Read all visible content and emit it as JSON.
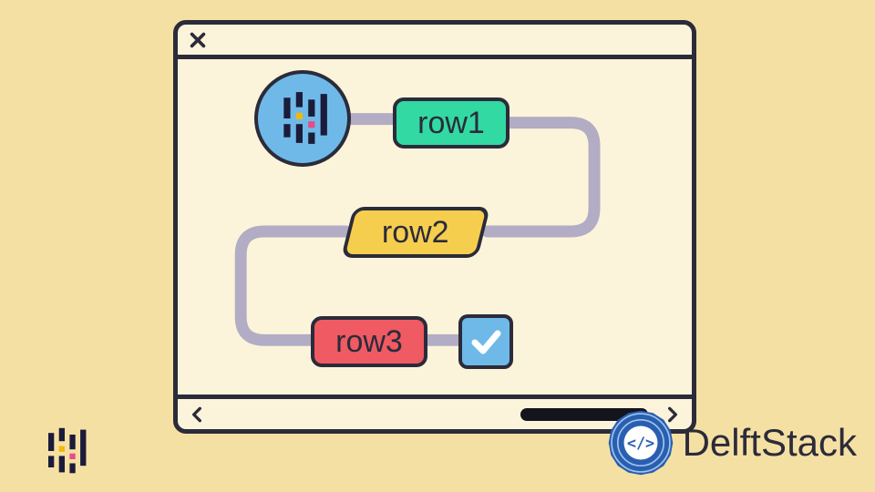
{
  "window": {
    "close": "×"
  },
  "flow": {
    "start_icon": "pandas-icon",
    "row1_label": "row1",
    "row2_label": "row2",
    "row3_label": "row3",
    "end_icon": "check-icon"
  },
  "statusbar": {
    "left_arrow": "<",
    "right_arrow": ">"
  },
  "brand": {
    "name": "DelftStack"
  },
  "colors": {
    "bg": "#f5e0a3",
    "window_bg": "#fcf4da",
    "stroke": "#2b2b3a",
    "circle": "#6fb9e8",
    "row1": "#33d9a3",
    "row2": "#f6ce4e",
    "row3": "#ef5a63",
    "brand_blue": "#2a5fb0",
    "connector": "#b2acc4"
  }
}
